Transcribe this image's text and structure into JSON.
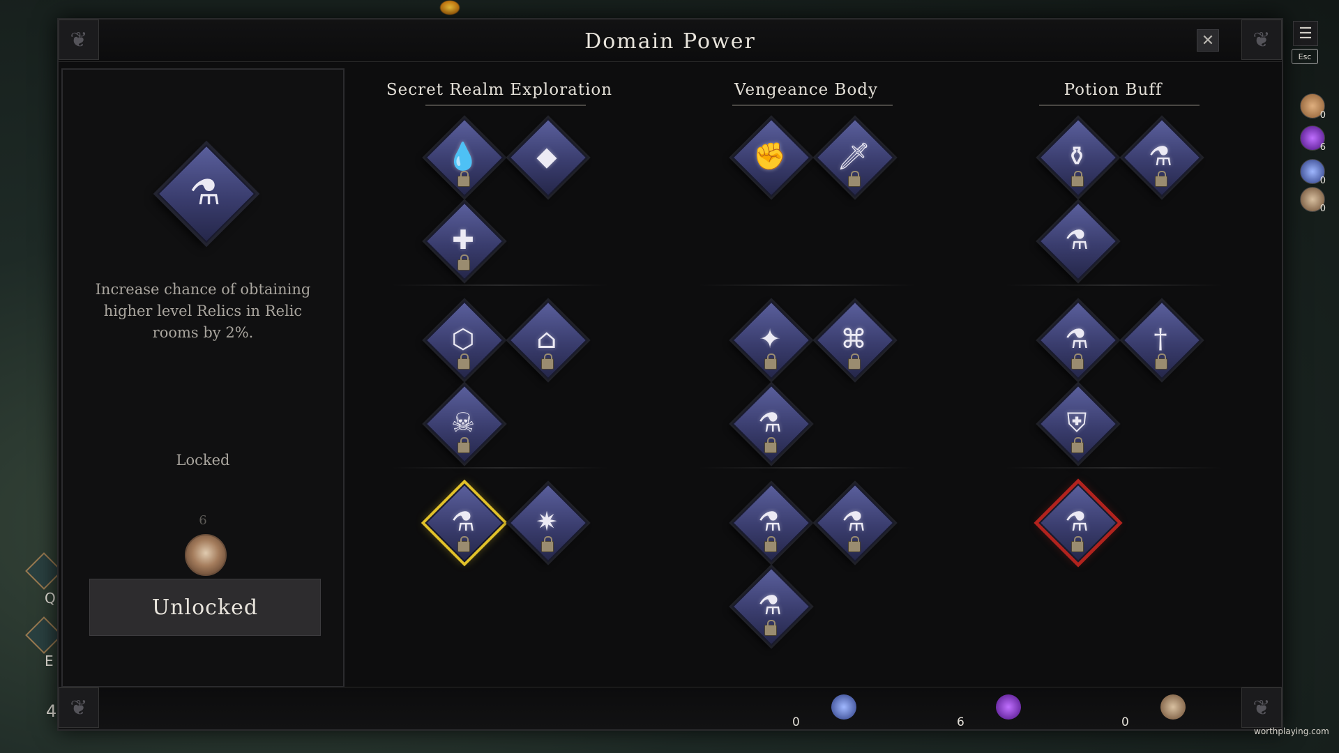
{
  "window": {
    "title": "Domain Power",
    "close_icon": "close-icon"
  },
  "detail": {
    "description": "Increase chance of obtaining higher level Relics in Relic rooms by 2%.",
    "status": "Locked",
    "cost": "6",
    "button_label": "Unlocked"
  },
  "columns": [
    {
      "title": "Secret Realm Exploration"
    },
    {
      "title": "Vengeance Body"
    },
    {
      "title": "Potion Buff"
    }
  ],
  "resources": [
    {
      "name": "crystal-cluster",
      "count": "0"
    },
    {
      "name": "purple-gem",
      "count": "6"
    },
    {
      "name": "bronze-medallion",
      "count": "0"
    }
  ],
  "side_resources": [
    {
      "name": "bronze-coin",
      "count": "0"
    },
    {
      "name": "purple-gem",
      "count": "6"
    },
    {
      "name": "crystal-cluster",
      "count": "0"
    },
    {
      "name": "bronze-medallion",
      "count": "0"
    }
  ],
  "hud": {
    "esc_label": "Esc",
    "hotkey_q": "Q",
    "hotkey_e": "E",
    "stack_count": "4",
    "watermark": "worthplaying.com"
  },
  "colors": {
    "selected_border": "#e2c22a",
    "warning_border": "#b2231e",
    "node_fill": "#3a3d6e"
  }
}
